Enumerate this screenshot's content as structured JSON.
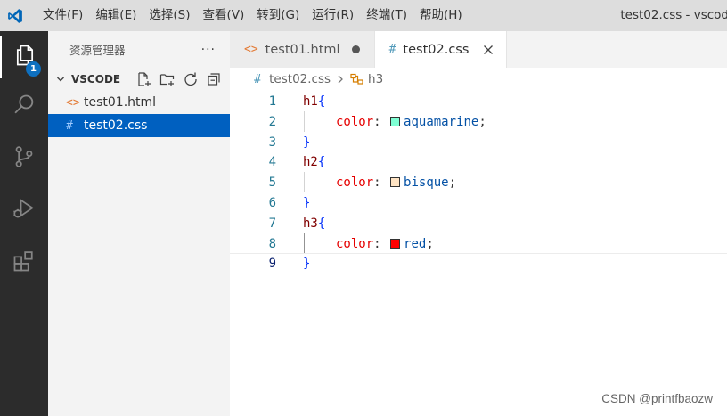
{
  "titlebar": {
    "menus": [
      "文件(F)",
      "编辑(E)",
      "选择(S)",
      "查看(V)",
      "转到(G)",
      "运行(R)",
      "终端(T)",
      "帮助(H)"
    ],
    "window_title": "test02.css - vscod"
  },
  "activitybar": {
    "explorer_badge": "1",
    "icons": [
      "files-icon",
      "search-icon",
      "source-control-icon",
      "run-debug-icon",
      "extensions-icon"
    ]
  },
  "sidebar": {
    "title": "资源管理器",
    "more": "···",
    "folder": "VSCODE",
    "files": [
      {
        "icon": "<>",
        "name": "test01.html"
      },
      {
        "icon": "#",
        "name": "test02.css"
      }
    ]
  },
  "tabs": [
    {
      "icon": "<>",
      "label": "test01.html"
    },
    {
      "icon": "#",
      "label": "test02.css"
    }
  ],
  "breadcrumb": {
    "icon": "#",
    "file": "test02.css",
    "symbol": "h3"
  },
  "editor": {
    "line_numbers": [
      "1",
      "2",
      "3",
      "4",
      "5",
      "6",
      "7",
      "8",
      "9"
    ],
    "lines": [
      {
        "selector": "h1",
        "brace": "{"
      },
      {
        "prop": "color",
        "colon": ":",
        "value": "aquamarine",
        "semi": ";",
        "swatch": "#7fffd4"
      },
      {
        "brace": "}"
      },
      {
        "selector": "h2",
        "brace": "{"
      },
      {
        "prop": "color",
        "colon": ":",
        "value": "bisque",
        "semi": ";",
        "swatch": "#ffe4c4"
      },
      {
        "brace": "}"
      },
      {
        "selector": "h3",
        "brace": "{"
      },
      {
        "prop": "color",
        "colon": ":",
        "value": "red",
        "semi": ";",
        "swatch": "#ff0000"
      },
      {
        "brace": "}"
      }
    ]
  },
  "watermark": "CSDN @printfbaozw",
  "colors": {
    "accent": "#0060c0",
    "badge": "#0e70c0",
    "activitybar": "#2c2c2c"
  }
}
